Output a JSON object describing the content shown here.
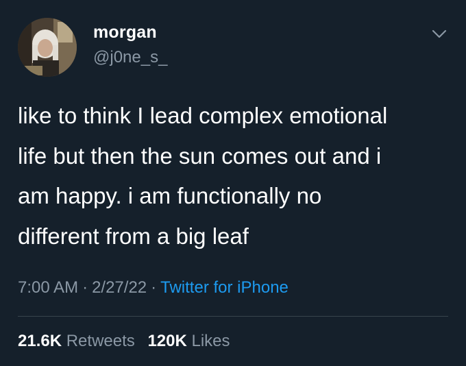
{
  "user": {
    "display_name": "morgan",
    "handle": "@j0ne_s_"
  },
  "tweet": {
    "lines": [
      "like to think I lead complex emotional",
      "life but then the sun comes out and i",
      "am happy. i am functionally no",
      "different from a big leaf"
    ]
  },
  "meta": {
    "time": "7:00 AM",
    "separator": "·",
    "date": "2/27/22",
    "source": "Twitter for iPhone"
  },
  "stats": {
    "retweets_count": "21.6K",
    "retweets_label": "Retweets",
    "likes_count": "120K",
    "likes_label": "Likes"
  },
  "icons": {
    "more": "chevron-down-icon"
  },
  "colors": {
    "background": "#15202b",
    "text": "#ffffff",
    "secondary_text": "#8b98a5",
    "link": "#1d9bf0",
    "divider": "#38444d"
  }
}
